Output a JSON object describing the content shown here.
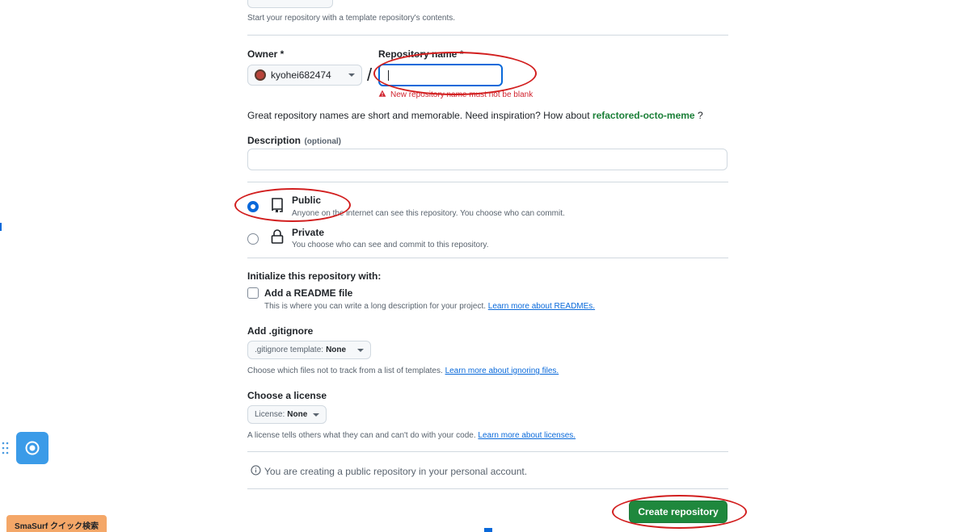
{
  "template": {
    "hint": "Start your repository with a template repository's contents."
  },
  "owner": {
    "label": "Owner *",
    "value": "kyohei682474",
    "avatar_color": "#b8443a"
  },
  "separator": "/",
  "repo_name": {
    "label": "Repository name *",
    "value": "",
    "error": "New repository name must not be blank"
  },
  "suggestion": {
    "prefix": "Great repository names are short and memorable. Need inspiration? How about",
    "name": "refactored-octo-meme",
    "suffix": "?"
  },
  "description": {
    "label": "Description",
    "optional": "(optional)",
    "value": ""
  },
  "visibility": {
    "public": {
      "label": "Public",
      "desc": "Anyone on the internet can see this repository. You choose who can commit.",
      "checked": true
    },
    "private": {
      "label": "Private",
      "desc": "You choose who can see and commit to this repository.",
      "checked": false
    }
  },
  "init": {
    "heading": "Initialize this repository with:",
    "readme_label": "Add a README file",
    "readme_desc": "This is where you can write a long description for your project.",
    "readme_link": "Learn more about READMEs."
  },
  "gitignore": {
    "heading": "Add .gitignore",
    "select_prefix": ".gitignore template:",
    "select_value": "None",
    "desc": "Choose which files not to track from a list of templates.",
    "link": "Learn more about ignoring files."
  },
  "license": {
    "heading": "Choose a license",
    "select_prefix": "License:",
    "select_value": "None",
    "desc": "A license tells others what they can and can't do with your code.",
    "link": "Learn more about licenses."
  },
  "notice": "You are creating a public repository in your personal account.",
  "create_button": "Create repository",
  "extension": {
    "label": "SmaSurf クイック検索"
  },
  "colors": {
    "primary_button": "#1f883d",
    "link": "#0969da",
    "error": "#d1242f",
    "annotation": "#d21f1f",
    "suggestion": "#1a7f37"
  }
}
